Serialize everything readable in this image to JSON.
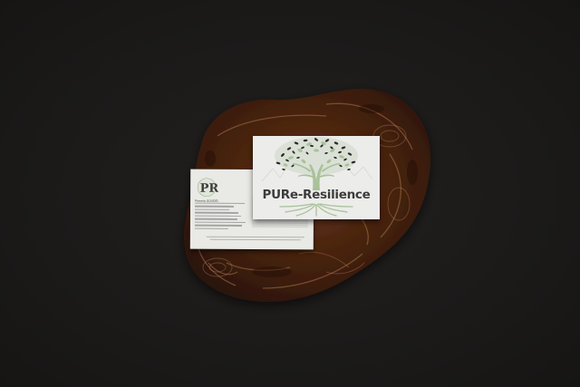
{
  "scene": {
    "background_color": "#1b1a19",
    "board_color": "#5a3018",
    "card_color": "#ececea"
  },
  "front_card": {
    "brand_name": "PURe-Resilience",
    "tree_leaf_color": "#a9c29a",
    "tree_dark_color": "#2a2a2a"
  },
  "back_card": {
    "logo_monogram": "PR",
    "contact_name": "Pamela GOUDEL",
    "logo_icon": "tree-monogram-icon"
  }
}
